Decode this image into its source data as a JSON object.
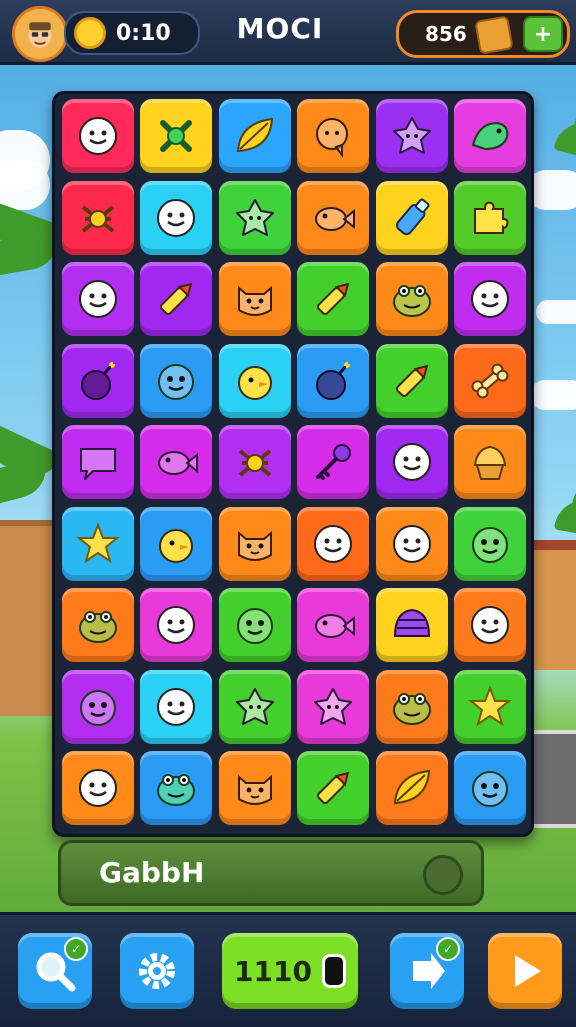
{
  "header": {
    "coins": "0:10",
    "title": "MOCI",
    "score": "856",
    "add_label": "+",
    "avatar_icon": "player-avatar-icon",
    "coin_icon": "gold-coin-icon",
    "chest_icon": "treasure-chest-icon"
  },
  "board": {
    "columns": 6,
    "rows": 9,
    "tiles": [
      {
        "color": "#ff2a5a",
        "icon": "smiley-face-icon"
      },
      {
        "color": "#ffd21e",
        "icon": "green-knot-icon"
      },
      {
        "color": "#2aa6ff",
        "icon": "leaf-icon"
      },
      {
        "color": "#ff8a1a",
        "icon": "chat-bubble-icon"
      },
      {
        "color": "#9b2ff2",
        "icon": "star-blob-icon"
      },
      {
        "color": "#e53ee0",
        "icon": "dragon-icon"
      },
      {
        "color": "#ff2a4a",
        "icon": "knot-icon"
      },
      {
        "color": "#2ad1f5",
        "icon": "smiley-face-icon"
      },
      {
        "color": "#3fd23a",
        "icon": "star-blob-icon"
      },
      {
        "color": "#ff8a1a",
        "icon": "fish-icon"
      },
      {
        "color": "#ffd21e",
        "icon": "bottle-icon"
      },
      {
        "color": "#53cc2a",
        "icon": "puzzle-icon"
      },
      {
        "color": "#b22ff2",
        "icon": "smiley-face-icon"
      },
      {
        "color": "#a028f0",
        "icon": "crayon-icon"
      },
      {
        "color": "#ff8a1a",
        "icon": "cat-face-icon"
      },
      {
        "color": "#44d02c",
        "icon": "crayon-icon"
      },
      {
        "color": "#ff8a1a",
        "icon": "frog-icon"
      },
      {
        "color": "#c02cf0",
        "icon": "smiley-face-icon"
      },
      {
        "color": "#a028f0",
        "icon": "bomb-icon"
      },
      {
        "color": "#2a9cf5",
        "icon": "monster-face-icon"
      },
      {
        "color": "#2ad1f5",
        "icon": "chick-icon"
      },
      {
        "color": "#2a9cf5",
        "icon": "bomb-icon"
      },
      {
        "color": "#44d02c",
        "icon": "crayon-icon"
      },
      {
        "color": "#ff6a1a",
        "icon": "bone-icon"
      },
      {
        "color": "#c02cf0",
        "icon": "speech-bubble-icon"
      },
      {
        "color": "#d42ce8",
        "icon": "fish-icon"
      },
      {
        "color": "#b22ff2",
        "icon": "knot-icon"
      },
      {
        "color": "#d42ce8",
        "icon": "key-icon"
      },
      {
        "color": "#a028f0",
        "icon": "smiley-face-icon"
      },
      {
        "color": "#ff8a1a",
        "icon": "cupcake-icon"
      },
      {
        "color": "#2ab8f5",
        "icon": "star-icon"
      },
      {
        "color": "#2a9cf5",
        "icon": "chick-icon"
      },
      {
        "color": "#ff8a1a",
        "icon": "cat-face-icon"
      },
      {
        "color": "#ff6a1a",
        "icon": "smiley-face-icon"
      },
      {
        "color": "#ff8a1a",
        "icon": "smiley-face-icon"
      },
      {
        "color": "#3fd23a",
        "icon": "monster-face-icon"
      },
      {
        "color": "#ff7a1a",
        "icon": "frog-icon"
      },
      {
        "color": "#e83ad8",
        "icon": "smiley-face-icon"
      },
      {
        "color": "#44d02c",
        "icon": "monster-face-icon"
      },
      {
        "color": "#e83ad8",
        "icon": "fish-icon"
      },
      {
        "color": "#ffd21e",
        "icon": "shell-icon"
      },
      {
        "color": "#ff7a1a",
        "icon": "smiley-face-icon"
      },
      {
        "color": "#b22ff2",
        "icon": "monster-face-icon"
      },
      {
        "color": "#2ad1f5",
        "icon": "smiley-face-icon"
      },
      {
        "color": "#44d02c",
        "icon": "star-blob-icon"
      },
      {
        "color": "#e83ad8",
        "icon": "star-blob-icon"
      },
      {
        "color": "#ff7a1a",
        "icon": "frog-icon"
      },
      {
        "color": "#44d02c",
        "icon": "star-icon"
      },
      {
        "color": "#ff8a1a",
        "icon": "smiley-face-icon"
      },
      {
        "color": "#2a9cf5",
        "icon": "frog-icon"
      },
      {
        "color": "#ff8a1a",
        "icon": "cat-face-icon"
      },
      {
        "color": "#44d02c",
        "icon": "crayon-icon"
      },
      {
        "color": "#ff7a1a",
        "icon": "leaf-icon"
      },
      {
        "color": "#2a9cf5",
        "icon": "monster-face-icon"
      }
    ]
  },
  "bottom_bar": {
    "label": "GabbH"
  },
  "footer": {
    "search_icon": "magnifier-icon",
    "settings_icon": "gear-icon",
    "timer": "1110",
    "next_icon": "arrow-right-icon",
    "play_icon": "play-icon"
  }
}
